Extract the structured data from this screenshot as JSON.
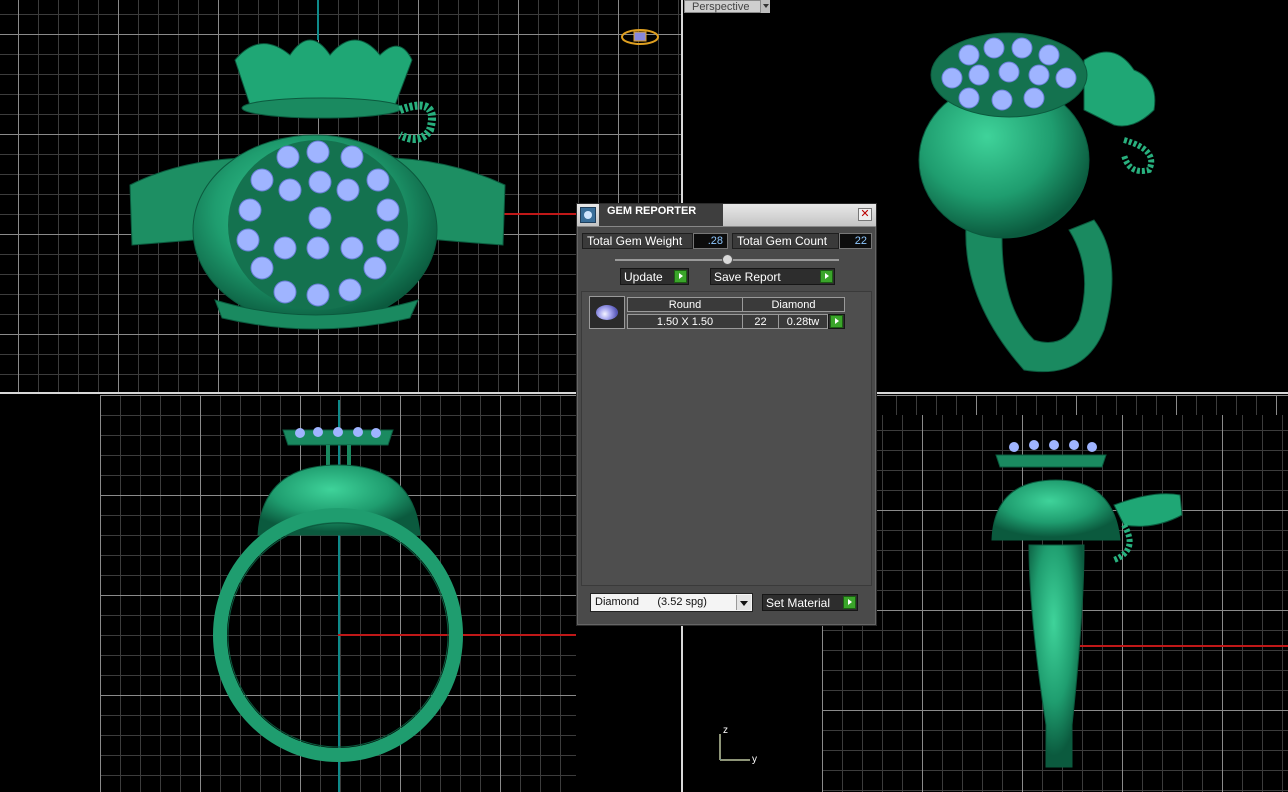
{
  "viewports": {
    "perspective_label": "Perspective"
  },
  "axis_indicator": {
    "z_label": "z",
    "y_label": "y"
  },
  "gem_reporter": {
    "title": "GEM REPORTER",
    "close_glyph": "✕",
    "total_gem_weight_label": "Total Gem Weight",
    "total_gem_weight_value": ".28",
    "total_gem_count_label": "Total Gem Count",
    "total_gem_count_value": "22",
    "update_label": "Update",
    "save_report_label": "Save Report",
    "gem_rows": [
      {
        "shape": "Round",
        "material": "Diamond",
        "size": "1.50 X 1.50",
        "count": "22",
        "weight": "0.28tw"
      }
    ],
    "material_select_value": "Diamond      (3.52 spg)",
    "set_material_label": "Set Material"
  },
  "colors": {
    "model": "#1f9d6f",
    "gem": "#9fb4ff",
    "x_axis": "#c01818",
    "y_axis": "#0e8a8a",
    "play_button": "#3aa52a",
    "value_text": "#8fc8ff"
  },
  "icons": {
    "title": "gem-reporter-icon",
    "close": "close-icon",
    "play": "play-arrow-icon",
    "dropdown": "chevron-down-icon",
    "gem": "round-diamond-icon"
  }
}
